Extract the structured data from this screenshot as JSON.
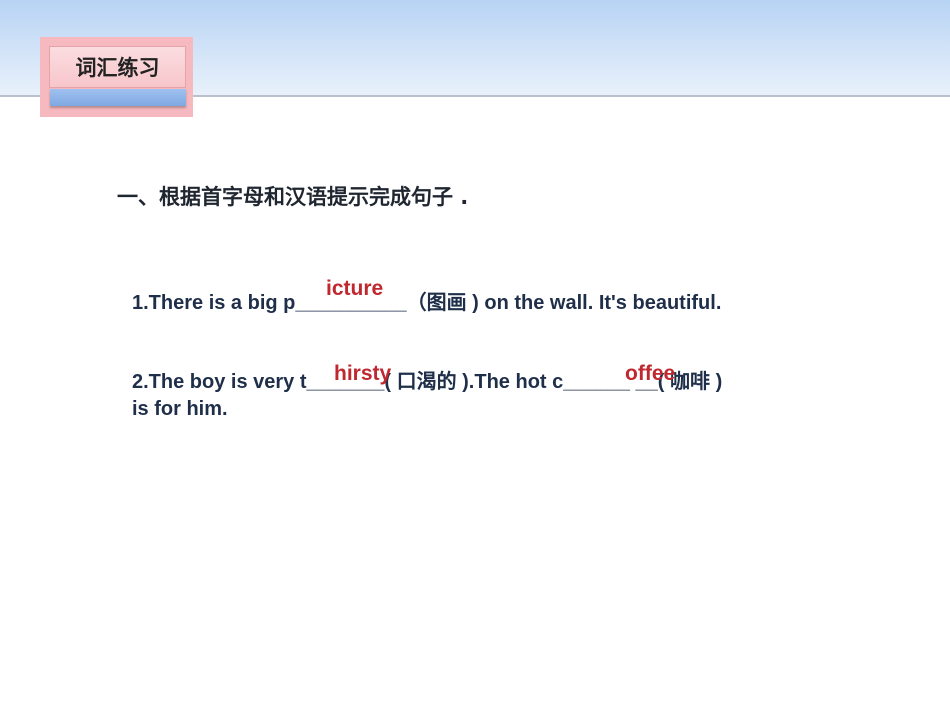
{
  "section_badge": {
    "label": "词汇练习"
  },
  "instruction": {
    "heading": "一、根据首字母和汉语提示完成句子 ."
  },
  "questions": [
    {
      "text": "1.There is a big p__________（图画 ) on the wall. It's beautiful.",
      "answer": "icture"
    },
    {
      "text": "2.The boy is very t_______( 口渴的 ).The hot c______ __( 咖啡 )",
      "continuation": "is for him.",
      "answer": "hirsty",
      "answer2": "offee"
    }
  ],
  "colors": {
    "answer": "#c0282f",
    "header_band": "#cfe1f7",
    "badge": "#f5b9bf",
    "badge_bar": "#8db3e8"
  }
}
